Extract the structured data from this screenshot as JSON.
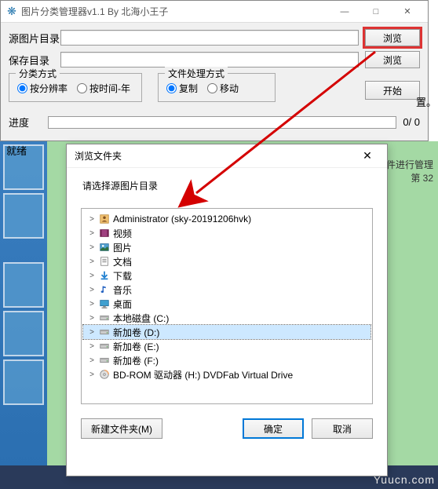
{
  "titlebar": {
    "title": "图片分类管理器v1.1 By 北海小王子",
    "minimize": "—",
    "maximize": "□",
    "close": "✕"
  },
  "form": {
    "source_label": "源图片目录",
    "save_label": "保存目录",
    "browse_btn": "浏览",
    "classify_legend": "分类方式",
    "classify_opt1": "按分辨率",
    "classify_opt2": "按时间-年",
    "process_legend": "文件处理方式",
    "process_opt1": "复制",
    "process_opt2": "移动",
    "start_btn": "开始",
    "progress_label": "进度",
    "progress_count": "0/  0",
    "status": "就绪"
  },
  "side": {
    "text1": "置。",
    "text2": "文件进行管理",
    "text3": "第 32"
  },
  "dialog": {
    "title": "浏览文件夹",
    "close": "✕",
    "subtitle": "请选择源图片目录",
    "newfolder_btn": "新建文件夹(M)",
    "ok_btn": "确定",
    "cancel_btn": "取消"
  },
  "tree": [
    {
      "icon": "user",
      "label": "Administrator (sky-20191206hvk)",
      "expand": ">"
    },
    {
      "icon": "video",
      "label": "视频",
      "expand": ">"
    },
    {
      "icon": "image",
      "label": "图片",
      "expand": ">"
    },
    {
      "icon": "doc",
      "label": "文档",
      "expand": ">"
    },
    {
      "icon": "download",
      "label": "下载",
      "expand": ">"
    },
    {
      "icon": "music",
      "label": "音乐",
      "expand": ">"
    },
    {
      "icon": "desktop",
      "label": "桌面",
      "expand": ">"
    },
    {
      "icon": "disk",
      "label": "本地磁盘 (C:)",
      "expand": ">"
    },
    {
      "icon": "disk",
      "label": "新加卷 (D:)",
      "expand": ">",
      "selected": true
    },
    {
      "icon": "disk",
      "label": "新加卷 (E:)",
      "expand": ">"
    },
    {
      "icon": "disk",
      "label": "新加卷 (F:)",
      "expand": ">"
    },
    {
      "icon": "cd",
      "label": "BD-ROM 驱动器 (H:) DVDFab Virtual Drive",
      "expand": ">"
    }
  ],
  "watermark": "Yuucn.com"
}
